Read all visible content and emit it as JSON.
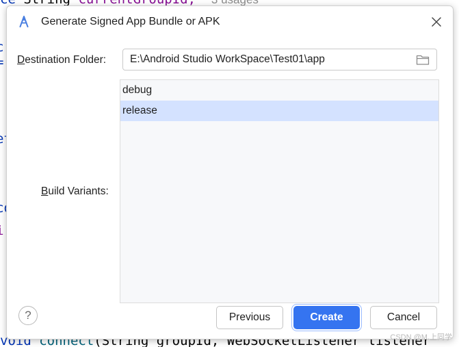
{
  "editor": {
    "line1": {
      "keyword": "ce",
      "type": "String",
      "field": "currentGroupId;",
      "hint": "3 usages"
    },
    "line2": {
      "keyword": "void",
      "method": "connect",
      "rest": "(String groupId, WebSocketListener listener"
    },
    "fragments": [
      "c",
      "=",
      "et",
      "co",
      "i"
    ]
  },
  "dialog": {
    "title": "Generate Signed App Bundle or APK",
    "destination": {
      "label_mnemonic": "D",
      "label_rest": "estination Folder:",
      "value": "E:\\Android Studio WorkSpace\\Test01\\app"
    },
    "build_variants": {
      "label_mnemonic": "B",
      "label_rest": "uild Variants:",
      "items": [
        "debug",
        "release"
      ],
      "selected": "release"
    },
    "buttons": {
      "help": "?",
      "previous": "Previous",
      "create": "Create",
      "cancel": "Cancel"
    }
  },
  "watermark": "CSDN @M.上同学",
  "colors": {
    "accent": "#3574f0",
    "selection": "#d4e2ff"
  }
}
